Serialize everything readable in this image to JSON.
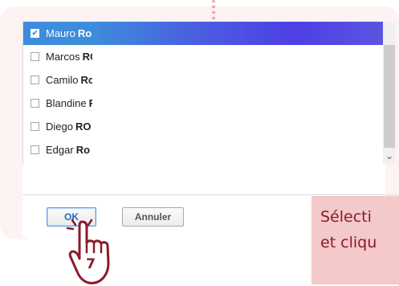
{
  "list": {
    "items": [
      {
        "first": "Mauro",
        "last": "Ro",
        "checked": true,
        "selected": true
      },
      {
        "first": "Marcos",
        "last": "RO",
        "checked": false,
        "selected": false
      },
      {
        "first": "Camilo",
        "last": "Rc",
        "checked": false,
        "selected": false
      },
      {
        "first": "Blandine",
        "last": "F",
        "checked": false,
        "selected": false
      },
      {
        "first": "Diego",
        "last": "RO",
        "checked": false,
        "selected": false
      },
      {
        "first": "Edgar",
        "last": "Ro",
        "checked": false,
        "selected": false
      }
    ],
    "check_glyph": "✔",
    "scroll_down_glyph": "⌄"
  },
  "buttons": {
    "ok_label": "OK",
    "cancel_label": "Annuler"
  },
  "tooltip": {
    "line1": "Sélecti",
    "line2": "et cliqu"
  },
  "step": {
    "number": "7"
  },
  "colors": {
    "selection": "#3d8ddc",
    "tooltip_bg": "#f3c9ca",
    "tooltip_text": "#8b1a2a",
    "card_bg": "#fdf3f3"
  },
  "icons": {
    "hand": "pointing-hand-icon",
    "checkbox": "checkbox-icon",
    "scroll_down": "chevron-down-icon"
  }
}
